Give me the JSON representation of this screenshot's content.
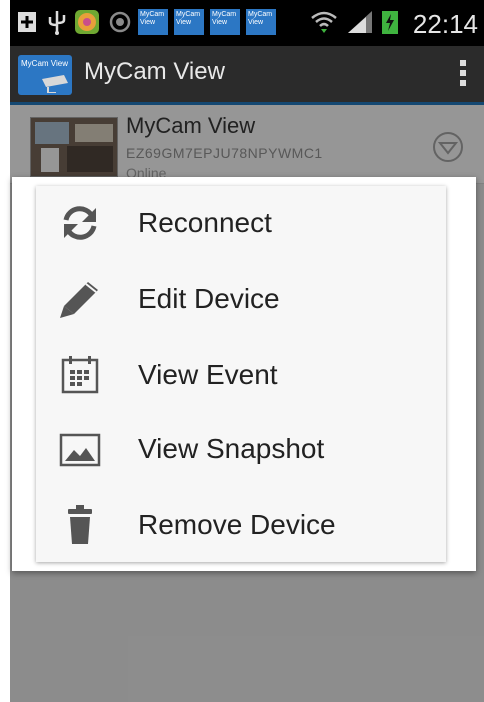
{
  "status_bar": {
    "time": "22:14",
    "icons": [
      "add-icon",
      "usb-icon",
      "app-icon",
      "app-icon",
      "mycam-view-icon",
      "mycam-view-icon",
      "mycam-view-icon",
      "mycam-view-icon",
      "wifi-icon",
      "signal-icon",
      "battery-charging-icon"
    ],
    "notif_app_label": "MyCam View"
  },
  "action_bar": {
    "app_icon_text": "MyCam View",
    "title": "MyCam View"
  },
  "device_list": {
    "items": [
      {
        "name": "MyCam View",
        "id": "EZ69GM7EPJU78NPYWMC1",
        "status": "Online"
      }
    ]
  },
  "context_menu": {
    "items": [
      {
        "label": "Reconnect",
        "icon": "refresh-icon"
      },
      {
        "label": "Edit Device",
        "icon": "pencil-icon"
      },
      {
        "label": "View Event",
        "icon": "calendar-icon"
      },
      {
        "label": "View Snapshot",
        "icon": "image-icon"
      },
      {
        "label": "Remove Device",
        "icon": "trash-icon"
      }
    ]
  },
  "colors": {
    "status_bar_bg": "#000000",
    "action_bar_bg": "#2b2b2b",
    "accent": "#1f6fb0",
    "menu_bg": "#f7f7f7",
    "icon_gray": "#555555"
  }
}
